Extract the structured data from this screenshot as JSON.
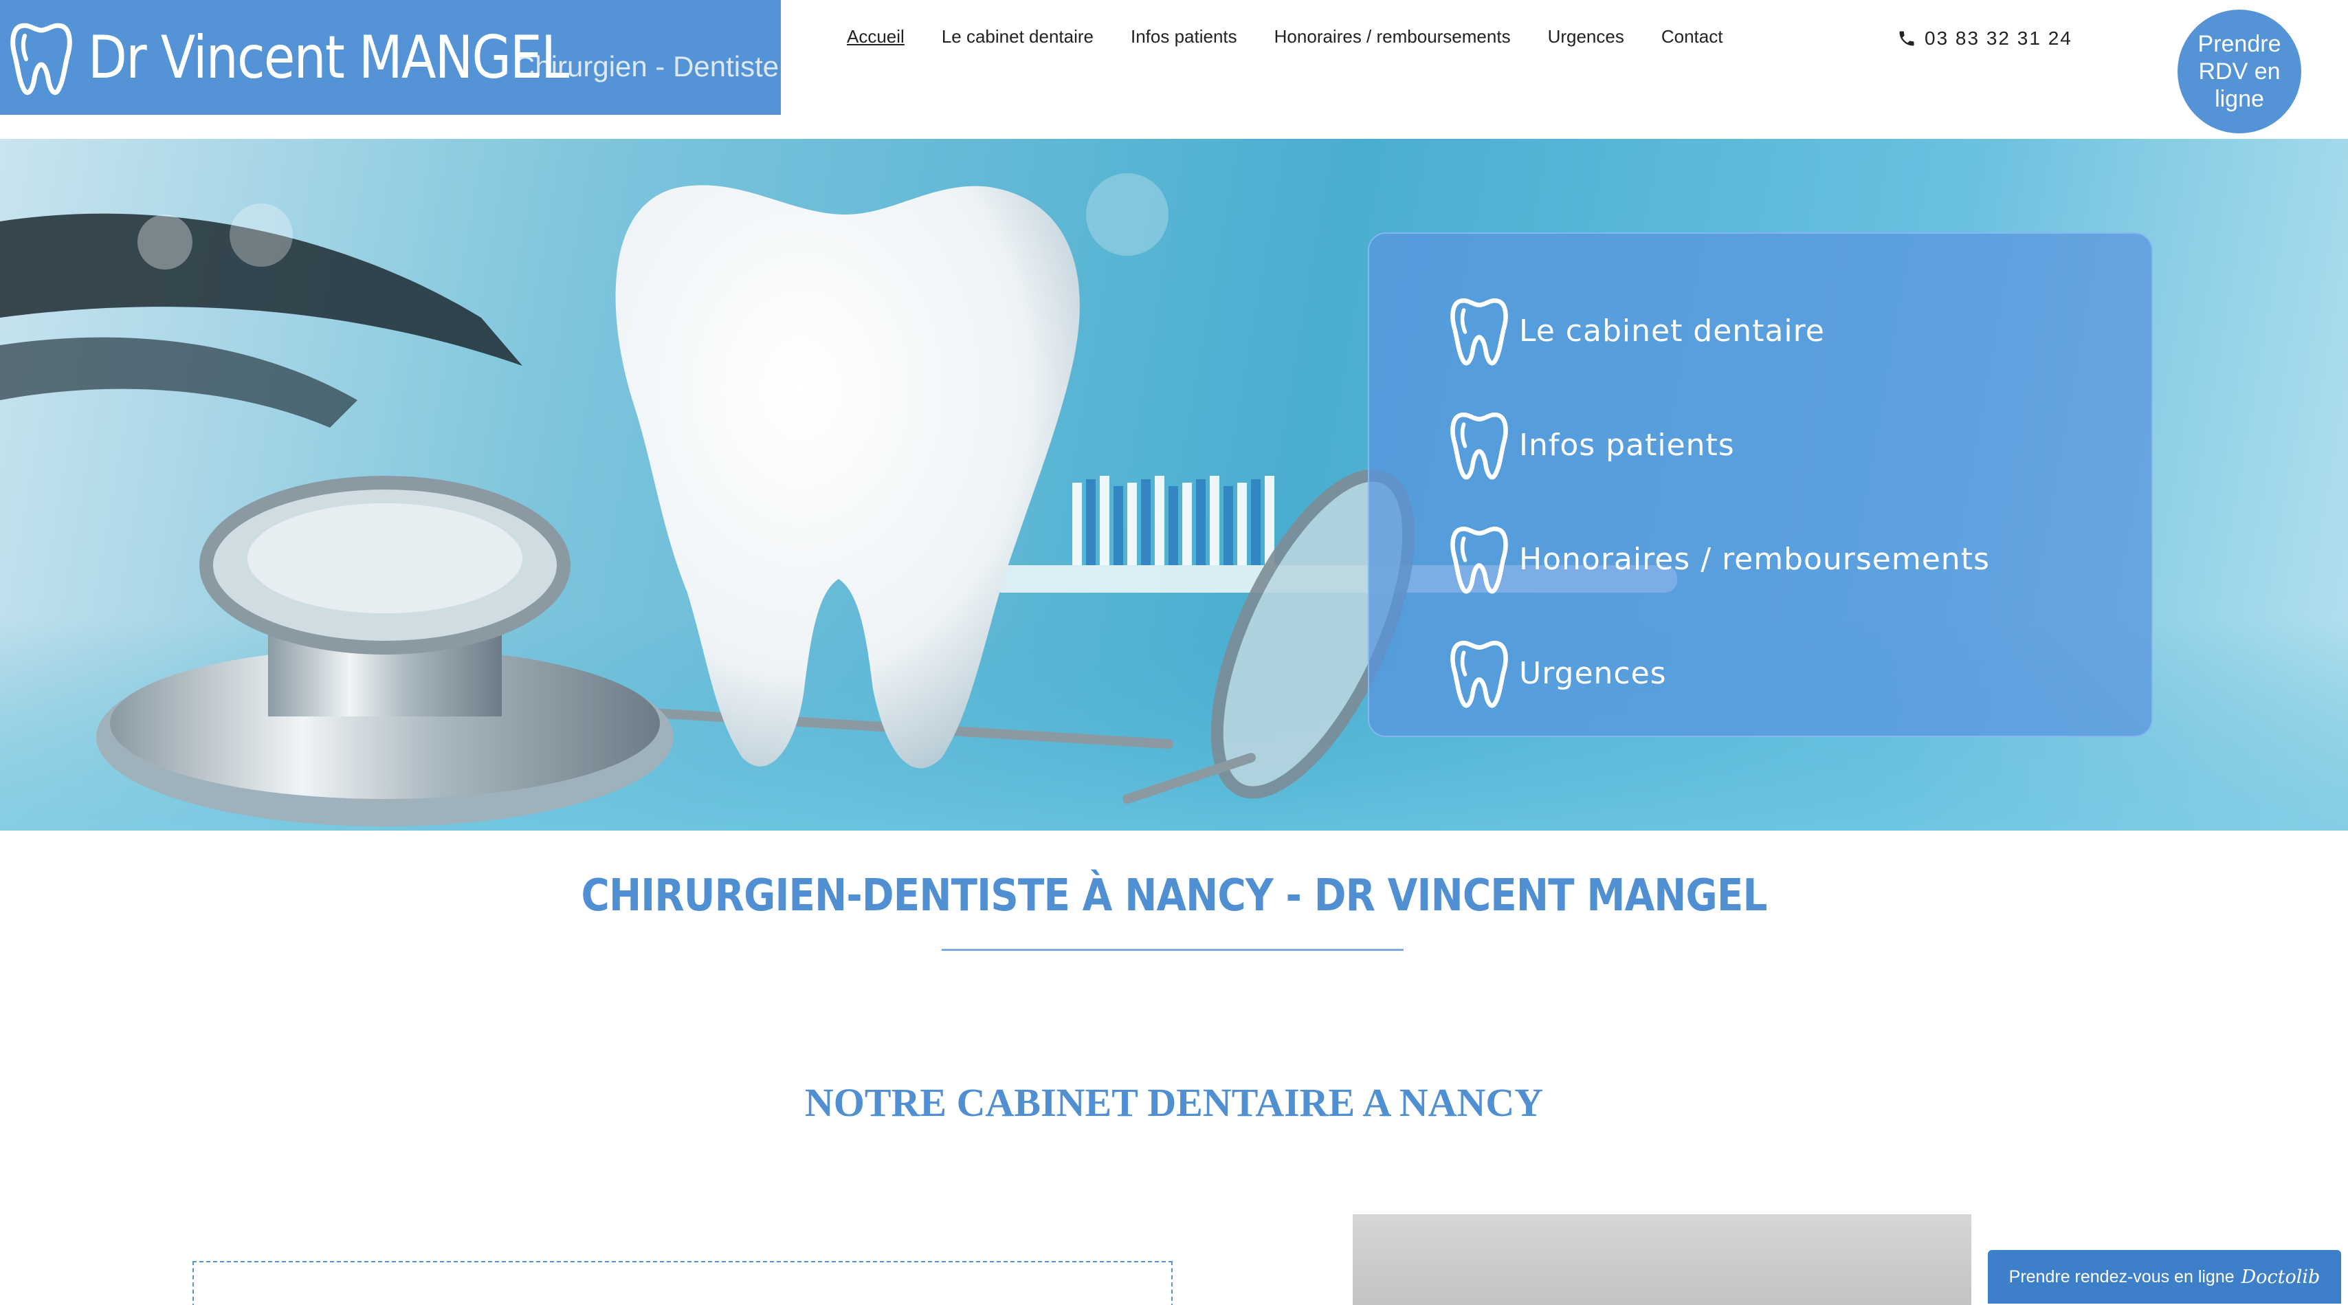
{
  "header": {
    "logo_name": "Dr Vincent MANGEL",
    "logo_subtitle": "Chirurgien - Dentiste",
    "nav": [
      {
        "label": "Accueil",
        "active": true
      },
      {
        "label": "Le cabinet dentaire",
        "active": false
      },
      {
        "label": "Infos patients",
        "active": false
      },
      {
        "label": "Honoraires / remboursements",
        "active": false
      },
      {
        "label": "Urgences",
        "active": false
      },
      {
        "label": "Contact",
        "active": false
      }
    ],
    "phone": "03 83 32 31 24",
    "rdv_button": "Prendre RDV en ligne"
  },
  "hero": {
    "panel_items": [
      {
        "label": "Le cabinet dentaire"
      },
      {
        "label": "Infos patients"
      },
      {
        "label": "Honoraires / remboursements"
      },
      {
        "label": "Urgences"
      }
    ]
  },
  "content": {
    "main_title": "CHIRURGIEN-DENTISTE À NANCY - DR VINCENT MANGEL",
    "section_title": "NOTRE CABINET DENTAIRE A NANCY"
  },
  "doctolib": {
    "label": "Prendre rendez-vous en ligne",
    "brand": "Doctolib"
  },
  "colors": {
    "brand_blue": "#5393d6",
    "title_blue": "#4f8fd2",
    "doctolib_blue": "#3d7fc8"
  },
  "icons": {
    "logo": "tooth-icon",
    "phone": "phone-icon",
    "panel": "tooth-icon"
  }
}
